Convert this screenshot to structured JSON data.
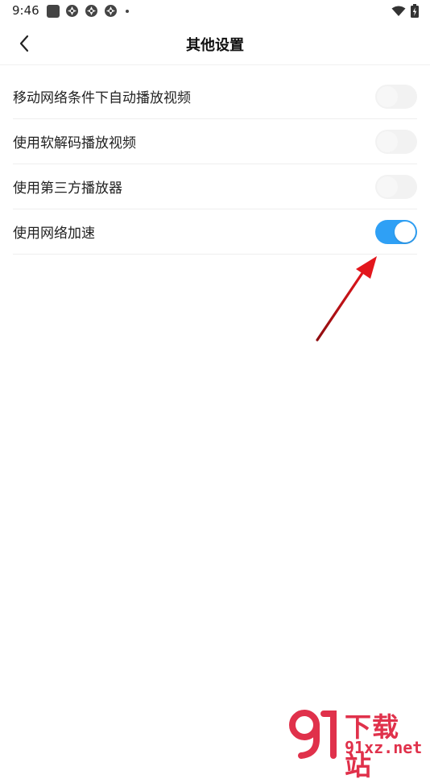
{
  "status_bar": {
    "time": "9:46",
    "left_icons": [
      "square-notification-icon",
      "app-notification-icon",
      "app-notification-icon",
      "app-notification-icon",
      "more-dot-icon"
    ],
    "right_icons": [
      "wifi-icon",
      "battery-charging-icon"
    ]
  },
  "header": {
    "title": "其他设置",
    "back_icon": "chevron-left-icon"
  },
  "settings": [
    {
      "label": "移动网络条件下自动播放视频",
      "enabled": false
    },
    {
      "label": "使用软解码播放视频",
      "enabled": false
    },
    {
      "label": "使用第三方播放器",
      "enabled": false
    },
    {
      "label": "使用网络加速",
      "enabled": true
    }
  ],
  "colors": {
    "toggle_on": "#2fa0f5",
    "toggle_off": "#f2f2f2",
    "annotation_arrow": "#d9141b",
    "watermark": "#e0314b"
  },
  "watermark": {
    "cn_text": "下载站",
    "en_text": "91xz.net"
  }
}
